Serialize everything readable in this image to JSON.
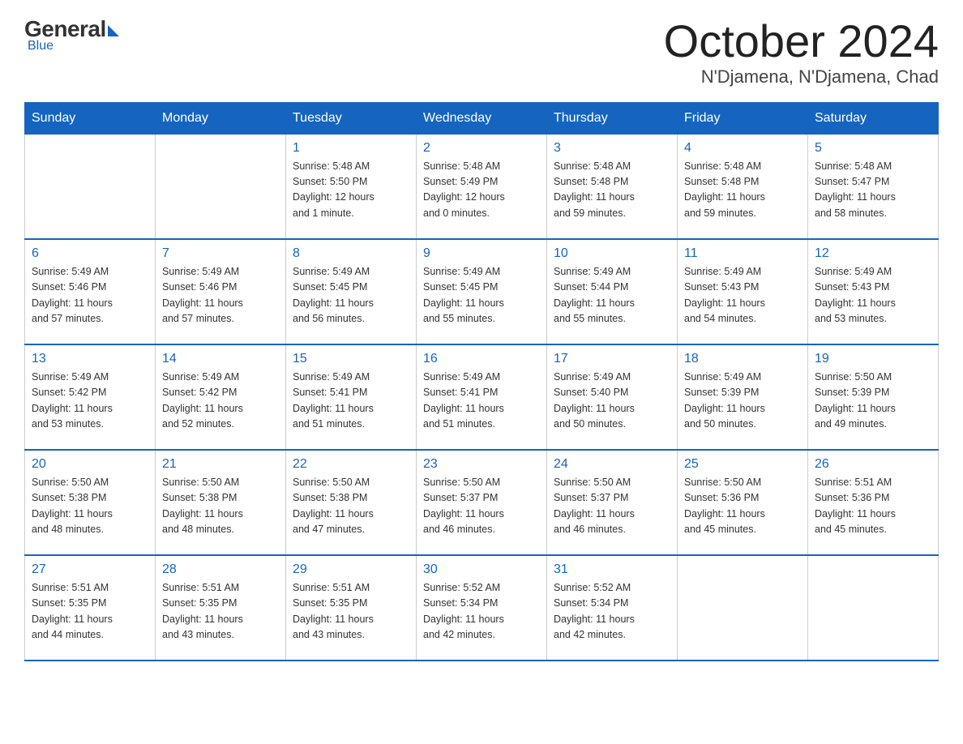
{
  "logo": {
    "general": "General",
    "blue": "Blue",
    "tagline": "Blue"
  },
  "header": {
    "month": "October 2024",
    "location": "N'Djamena, N'Djamena, Chad"
  },
  "weekdays": [
    "Sunday",
    "Monday",
    "Tuesday",
    "Wednesday",
    "Thursday",
    "Friday",
    "Saturday"
  ],
  "weeks": [
    [
      {
        "day": "",
        "info": ""
      },
      {
        "day": "",
        "info": ""
      },
      {
        "day": "1",
        "info": "Sunrise: 5:48 AM\nSunset: 5:50 PM\nDaylight: 12 hours\nand 1 minute."
      },
      {
        "day": "2",
        "info": "Sunrise: 5:48 AM\nSunset: 5:49 PM\nDaylight: 12 hours\nand 0 minutes."
      },
      {
        "day": "3",
        "info": "Sunrise: 5:48 AM\nSunset: 5:48 PM\nDaylight: 11 hours\nand 59 minutes."
      },
      {
        "day": "4",
        "info": "Sunrise: 5:48 AM\nSunset: 5:48 PM\nDaylight: 11 hours\nand 59 minutes."
      },
      {
        "day": "5",
        "info": "Sunrise: 5:48 AM\nSunset: 5:47 PM\nDaylight: 11 hours\nand 58 minutes."
      }
    ],
    [
      {
        "day": "6",
        "info": "Sunrise: 5:49 AM\nSunset: 5:46 PM\nDaylight: 11 hours\nand 57 minutes."
      },
      {
        "day": "7",
        "info": "Sunrise: 5:49 AM\nSunset: 5:46 PM\nDaylight: 11 hours\nand 57 minutes."
      },
      {
        "day": "8",
        "info": "Sunrise: 5:49 AM\nSunset: 5:45 PM\nDaylight: 11 hours\nand 56 minutes."
      },
      {
        "day": "9",
        "info": "Sunrise: 5:49 AM\nSunset: 5:45 PM\nDaylight: 11 hours\nand 55 minutes."
      },
      {
        "day": "10",
        "info": "Sunrise: 5:49 AM\nSunset: 5:44 PM\nDaylight: 11 hours\nand 55 minutes."
      },
      {
        "day": "11",
        "info": "Sunrise: 5:49 AM\nSunset: 5:43 PM\nDaylight: 11 hours\nand 54 minutes."
      },
      {
        "day": "12",
        "info": "Sunrise: 5:49 AM\nSunset: 5:43 PM\nDaylight: 11 hours\nand 53 minutes."
      }
    ],
    [
      {
        "day": "13",
        "info": "Sunrise: 5:49 AM\nSunset: 5:42 PM\nDaylight: 11 hours\nand 53 minutes."
      },
      {
        "day": "14",
        "info": "Sunrise: 5:49 AM\nSunset: 5:42 PM\nDaylight: 11 hours\nand 52 minutes."
      },
      {
        "day": "15",
        "info": "Sunrise: 5:49 AM\nSunset: 5:41 PM\nDaylight: 11 hours\nand 51 minutes."
      },
      {
        "day": "16",
        "info": "Sunrise: 5:49 AM\nSunset: 5:41 PM\nDaylight: 11 hours\nand 51 minutes."
      },
      {
        "day": "17",
        "info": "Sunrise: 5:49 AM\nSunset: 5:40 PM\nDaylight: 11 hours\nand 50 minutes."
      },
      {
        "day": "18",
        "info": "Sunrise: 5:49 AM\nSunset: 5:39 PM\nDaylight: 11 hours\nand 50 minutes."
      },
      {
        "day": "19",
        "info": "Sunrise: 5:50 AM\nSunset: 5:39 PM\nDaylight: 11 hours\nand 49 minutes."
      }
    ],
    [
      {
        "day": "20",
        "info": "Sunrise: 5:50 AM\nSunset: 5:38 PM\nDaylight: 11 hours\nand 48 minutes."
      },
      {
        "day": "21",
        "info": "Sunrise: 5:50 AM\nSunset: 5:38 PM\nDaylight: 11 hours\nand 48 minutes."
      },
      {
        "day": "22",
        "info": "Sunrise: 5:50 AM\nSunset: 5:38 PM\nDaylight: 11 hours\nand 47 minutes."
      },
      {
        "day": "23",
        "info": "Sunrise: 5:50 AM\nSunset: 5:37 PM\nDaylight: 11 hours\nand 46 minutes."
      },
      {
        "day": "24",
        "info": "Sunrise: 5:50 AM\nSunset: 5:37 PM\nDaylight: 11 hours\nand 46 minutes."
      },
      {
        "day": "25",
        "info": "Sunrise: 5:50 AM\nSunset: 5:36 PM\nDaylight: 11 hours\nand 45 minutes."
      },
      {
        "day": "26",
        "info": "Sunrise: 5:51 AM\nSunset: 5:36 PM\nDaylight: 11 hours\nand 45 minutes."
      }
    ],
    [
      {
        "day": "27",
        "info": "Sunrise: 5:51 AM\nSunset: 5:35 PM\nDaylight: 11 hours\nand 44 minutes."
      },
      {
        "day": "28",
        "info": "Sunrise: 5:51 AM\nSunset: 5:35 PM\nDaylight: 11 hours\nand 43 minutes."
      },
      {
        "day": "29",
        "info": "Sunrise: 5:51 AM\nSunset: 5:35 PM\nDaylight: 11 hours\nand 43 minutes."
      },
      {
        "day": "30",
        "info": "Sunrise: 5:52 AM\nSunset: 5:34 PM\nDaylight: 11 hours\nand 42 minutes."
      },
      {
        "day": "31",
        "info": "Sunrise: 5:52 AM\nSunset: 5:34 PM\nDaylight: 11 hours\nand 42 minutes."
      },
      {
        "day": "",
        "info": ""
      },
      {
        "day": "",
        "info": ""
      }
    ]
  ]
}
